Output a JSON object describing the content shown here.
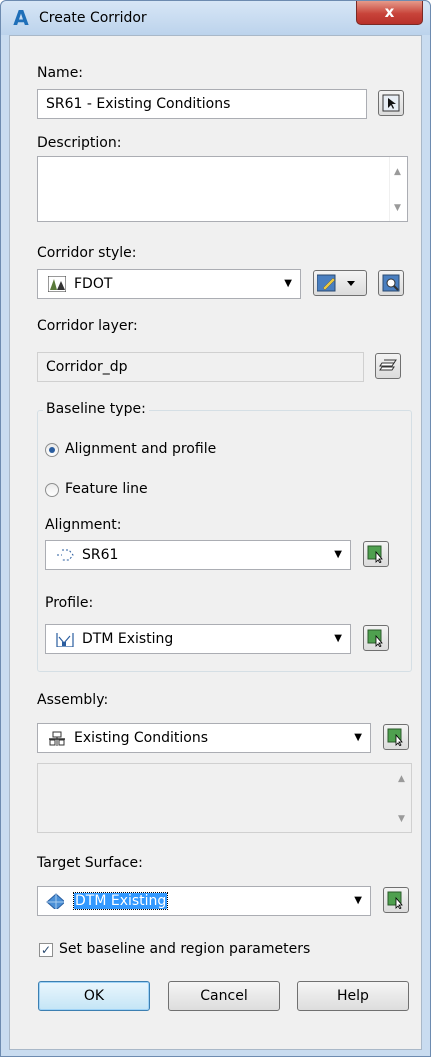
{
  "window": {
    "title": "Create Corridor",
    "close_glyph": "x"
  },
  "name": {
    "label": "Name:",
    "value": "SR61 - Existing Conditions"
  },
  "description": {
    "label": "Description:",
    "value": ""
  },
  "corridor_style": {
    "label": "Corridor style:",
    "value": "FDOT"
  },
  "corridor_layer": {
    "label": "Corridor layer:",
    "value": "Corridor_dp"
  },
  "baseline_type": {
    "title": "Baseline type:",
    "options": [
      {
        "label": "Alignment and profile",
        "selected": true
      },
      {
        "label": "Feature line",
        "selected": false
      }
    ],
    "alignment": {
      "label": "Alignment:",
      "value": "SR61"
    },
    "profile": {
      "label": "Profile:",
      "value": "DTM Existing"
    }
  },
  "assembly": {
    "label": "Assembly:",
    "value": "Existing Conditions"
  },
  "target_surface": {
    "label": "Target Surface:",
    "value": "DTM Existing"
  },
  "set_baseline": {
    "label": "Set baseline and region parameters",
    "checked": true,
    "check_glyph": "✓"
  },
  "buttons": {
    "ok": "OK",
    "cancel": "Cancel",
    "help": "Help"
  },
  "glyphs": {
    "dropdown_arrow": "▼",
    "scroll_up": "▲",
    "scroll_down": "▼",
    "app_letter": "A"
  },
  "icons": {
    "app": "autocad-a-icon",
    "pick": "pick-from-drawing-icon",
    "style_edit": "edit-style-icon",
    "style_preview": "preview-style-icon",
    "layer": "layer-icon",
    "alignment": "alignment-icon",
    "profile": "profile-icon",
    "assembly": "assembly-icon",
    "surface": "surface-icon",
    "select_object": "select-object-icon"
  }
}
